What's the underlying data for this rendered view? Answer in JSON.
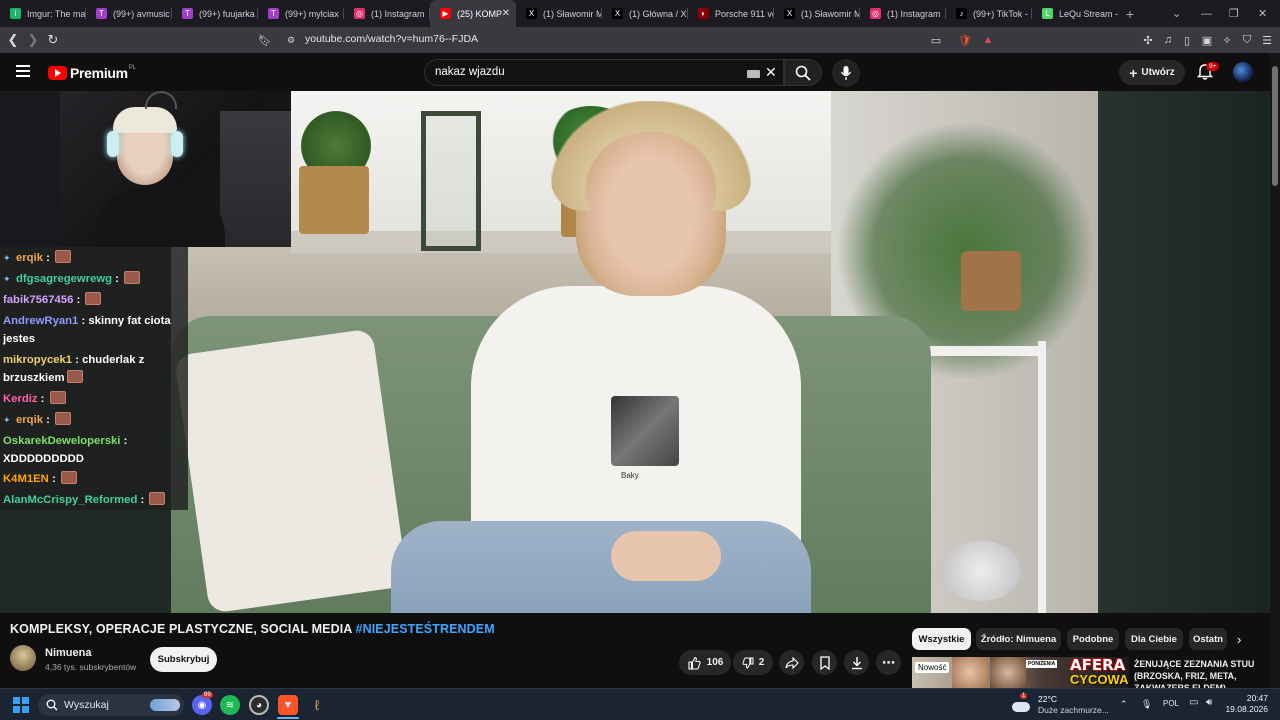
{
  "browser": {
    "tabs": [
      {
        "label": "Imgur: The ma",
        "color": "#1bb76e",
        "glyph": "i"
      },
      {
        "label": "(99+) avmusic",
        "color": "#a33ec8",
        "glyph": "T"
      },
      {
        "label": "(99+) fuujarka",
        "color": "#a33ec8",
        "glyph": "T"
      },
      {
        "label": "(99+) mylciax",
        "color": "#a33ec8",
        "glyph": "T"
      },
      {
        "label": "(1) Instagram",
        "color": "#e1306c",
        "glyph": "◎"
      },
      {
        "label": "(25) KOMP",
        "color": "#ff0000",
        "glyph": "▶",
        "active": true
      },
      {
        "label": "(1) Sławomir M",
        "color": "#000000",
        "glyph": "X"
      },
      {
        "label": "(1) Główna / X",
        "color": "#000000",
        "glyph": "X"
      },
      {
        "label": "Porsche 911 ve",
        "color": "#8b0000",
        "glyph": "◐"
      },
      {
        "label": "(1) Sławomir M",
        "color": "#000000",
        "glyph": "X"
      },
      {
        "label": "(1) Instagram",
        "color": "#e1306c",
        "glyph": "◎"
      },
      {
        "label": "(99+) TikTok -",
        "color": "#000000",
        "glyph": "♪"
      },
      {
        "label": "LeQu Stream -",
        "color": "#53d769",
        "glyph": "L"
      }
    ],
    "new_tab": "+",
    "url": "youtube.com/watch?v=hum76--FJDA"
  },
  "youtube": {
    "logo_word": "Premium",
    "logo_region": "PL",
    "search_value": "nakaz wjazdu",
    "create_label": "Utwórz",
    "notification_count": "9+"
  },
  "chat": [
    {
      "user": "erqik",
      "color": "#f0a64b",
      "text": "",
      "emote": true,
      "badge": true
    },
    {
      "user": "dfgsagregewrewg",
      "color": "#3fd0a0",
      "text": "",
      "emote": true,
      "badge": true
    },
    {
      "user": "fabik7567456",
      "color": "#d7a0ff",
      "text": "",
      "emote": true,
      "badge": false
    },
    {
      "user": "AndrewRyan1",
      "color": "#8f9bff",
      "text": "skinny fat ciota jestes",
      "emote": false,
      "badge": false
    },
    {
      "user": "mikropycek1",
      "color": "#f0d070",
      "text": "chuderlak z brzuszkiem",
      "emote": true,
      "badge": false
    },
    {
      "user": "Kerdiz",
      "color": "#ff5fb0",
      "text": "",
      "emote": true,
      "badge": false
    },
    {
      "user": "erqik",
      "color": "#f0a64b",
      "text": "",
      "emote": true,
      "badge": true
    },
    {
      "user": "OskarekDeweloperski",
      "color": "#7ee06a",
      "text": "XDDDDDDDDD",
      "emote": false,
      "badge": false
    },
    {
      "user": "K4M1EN",
      "color": "#ffa500",
      "text": "",
      "emote": true,
      "badge": false
    },
    {
      "user": "AlanMcCrispy_Reformed",
      "color": "#3fd0a0",
      "text": "",
      "emote": true,
      "badge": false
    }
  ],
  "video": {
    "shirt_text": "Baky",
    "title_main": "KOMPLEKSY, OPERACJE PLASTYCZNE, SOCIAL MEDIA ",
    "title_tag": "#NIEJESTEŚTRENDEM",
    "channel_name": "Nimuena",
    "subscribers": "4,36 tys. subskrybentów",
    "subscribe_label": "Subskrybuj",
    "likes": "106",
    "dislikes": "2"
  },
  "chips": [
    "Wszystkie",
    "Źródło: Nimuena",
    "Podobne",
    "Dla Ciebie",
    "Ostatn"
  ],
  "recommendation": {
    "badge": "Nowość",
    "thumb_title_1": "AFERA",
    "thumb_title_2": "CYCOWA",
    "thumb_small": "PONIŻENIA",
    "title": "ŻENUJĄCE ZEZNANIA STUU (BRZOSKA, FRIZ, META, ZAKWAZERS ELDEM)"
  },
  "taskbar": {
    "search_label": "Wyszukaj",
    "discord_badge": "99",
    "weather_alert": "1",
    "temperature": "22°C",
    "weather_text": "Duże zachmurze...",
    "language": "POL",
    "time": "20:47",
    "date": "19.08.2026"
  }
}
